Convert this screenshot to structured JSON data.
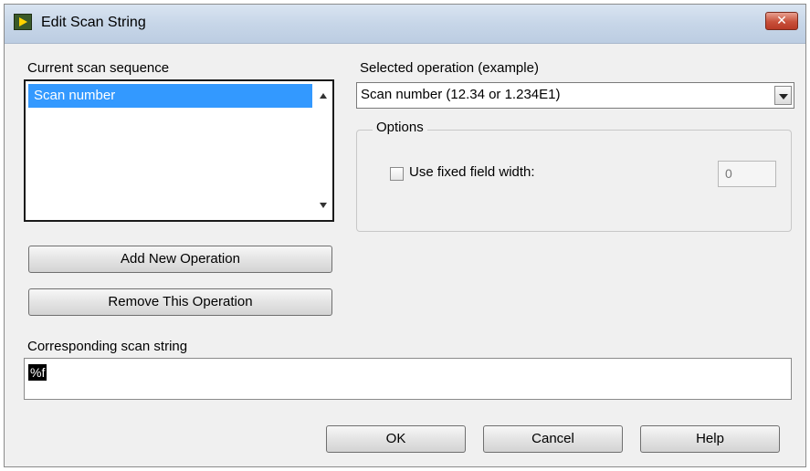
{
  "window": {
    "title": "Edit Scan String",
    "close_label": "✕"
  },
  "sequence": {
    "label": "Current scan sequence",
    "items": [
      "Scan number"
    ],
    "selected_index": 0
  },
  "buttons": {
    "add_operation": "Add New Operation",
    "remove_operation": "Remove This Operation",
    "ok": "OK",
    "cancel": "Cancel",
    "help": "Help"
  },
  "operation": {
    "label": "Selected operation (example)",
    "selected_value": "Scan number (12.34 or 1.234E1)"
  },
  "options": {
    "title": "Options",
    "fixed_width_label": "Use fixed field width:",
    "fixed_width_checked": false,
    "fixed_width_value": "0"
  },
  "scan_string": {
    "label": "Corresponding scan string",
    "value": "%f"
  },
  "colors": {
    "selection": "#3399ff",
    "dialog_bg": "#f0f0f0",
    "close_red": "#c8503a"
  }
}
